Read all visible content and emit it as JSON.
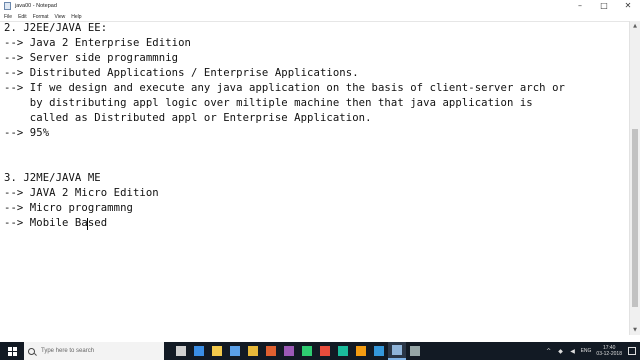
{
  "window": {
    "title": "java00 - Notepad",
    "minimize_glyph": "–",
    "maximize_glyph": "□",
    "close_glyph": "✕"
  },
  "menu": [
    {
      "label": "File"
    },
    {
      "label": "Edit"
    },
    {
      "label": "Format"
    },
    {
      "label": "View"
    },
    {
      "label": "Help"
    }
  ],
  "document": {
    "lines": [
      "2. J2EE/JAVA EE:",
      "--> Java 2 Enterprise Edition",
      "--> Server side programmnig",
      "--> Distributed Applications / Enterprise Applications.",
      "--> If we design and execute any java application on the basis of client-server arch or",
      "    by distributing appl logic over miltiple machine then that java application is",
      "    called as Distributed appl or Enterprise Application.",
      "--> 95%",
      "",
      "",
      "3. J2ME/JAVA ME",
      "--> JAVA 2 Micro Edition",
      "--> Micro programmng",
      "--> Mobile Based"
    ]
  },
  "scrollbar": {
    "up_glyph": "▲",
    "down_glyph": "▼"
  },
  "taskbar": {
    "search_placeholder": "Type here to search",
    "apps": [
      {
        "icon": "task-view-icon",
        "color": "#d0d0d0"
      },
      {
        "icon": "edge-icon",
        "color": "#3a8ee6"
      },
      {
        "icon": "file-explorer-icon",
        "color": "#f2c94c"
      },
      {
        "icon": "store-icon",
        "color": "#5aa0e8"
      },
      {
        "icon": "chrome-icon",
        "color": "#e8b93a"
      },
      {
        "icon": "media-icon",
        "color": "#e06030"
      },
      {
        "icon": "app-icon-1",
        "color": "#9b59b6"
      },
      {
        "icon": "app-icon-2",
        "color": "#2ecc71"
      },
      {
        "icon": "app-icon-3",
        "color": "#e74c3c"
      },
      {
        "icon": "app-icon-4",
        "color": "#1abc9c"
      },
      {
        "icon": "app-icon-5",
        "color": "#f39c12"
      },
      {
        "icon": "app-icon-6",
        "color": "#3498db"
      },
      {
        "icon": "notepad-icon",
        "color": "#8fb4d9"
      },
      {
        "icon": "app-icon-7",
        "color": "#95a5a6"
      }
    ],
    "language": "ENG",
    "time": "17:40",
    "date": "03-12-2018"
  }
}
